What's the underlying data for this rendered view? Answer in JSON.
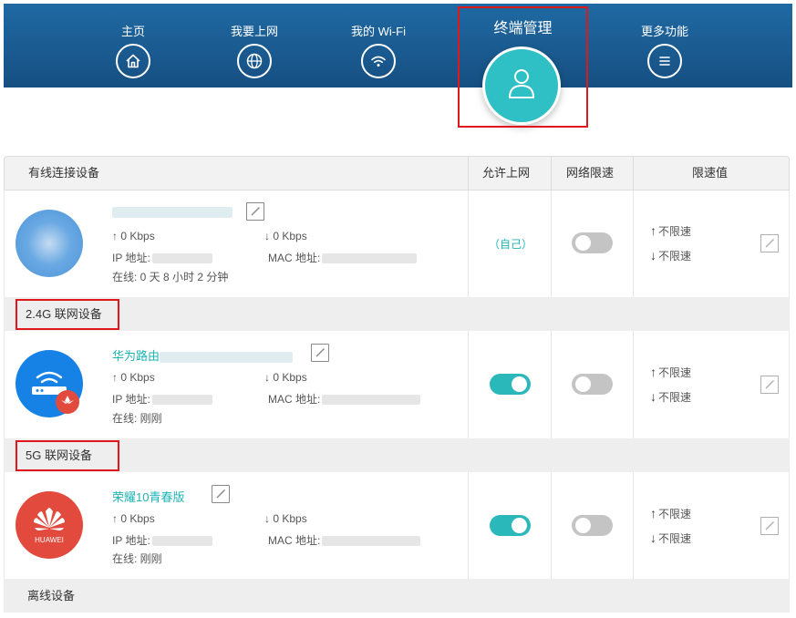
{
  "nav": {
    "items": [
      {
        "label": "主页",
        "icon": "home-icon"
      },
      {
        "label": "我要上网",
        "icon": "globe-icon"
      },
      {
        "label": "我的 Wi-Fi",
        "icon": "wifi-icon"
      },
      {
        "label": "终端管理",
        "icon": "user-icon",
        "active": true
      },
      {
        "label": "更多功能",
        "icon": "menu-icon"
      }
    ]
  },
  "table": {
    "headers": {
      "device": "有线连接设备",
      "allow": "允许上网",
      "limit": "网络限速",
      "limit_value": "限速值"
    },
    "wired": {
      "up": "↑ 0 Kbps",
      "down": "↓ 0 Kbps",
      "ip_label": "IP 地址:",
      "mac_label": "MAC 地址:",
      "online": "在线: 0 天 8 小时 2 分钟",
      "allow": "（自己）",
      "limit_up": "不限速",
      "limit_down": "不限速",
      "speed_limit_on": false
    },
    "band24": {
      "title": "2.4G 联网设备",
      "name": "华为路由",
      "up": "↑ 0 Kbps",
      "down": "↓ 0 Kbps",
      "ip_label": "IP 地址:",
      "mac_label": "MAC 地址:",
      "online": "在线: 刚刚",
      "allow_on": true,
      "speed_limit_on": false,
      "limit_up": "不限速",
      "limit_down": "不限速"
    },
    "band5": {
      "title": "5G 联网设备",
      "name": "荣耀10青春版",
      "up": "↑ 0 Kbps",
      "down": "↓ 0 Kbps",
      "ip_label": "IP 地址:",
      "mac_label": "MAC 地址:",
      "online": "在线: 刚刚",
      "allow_on": true,
      "speed_limit_on": false,
      "limit_up": "不限速",
      "limit_down": "不限速",
      "brand": "HUAWEI"
    },
    "offline": {
      "title": "离线设备"
    }
  },
  "colors": {
    "nav_bg": "#1a5d93",
    "accent": "#2ab8bb",
    "highlight": "#e0171b"
  }
}
